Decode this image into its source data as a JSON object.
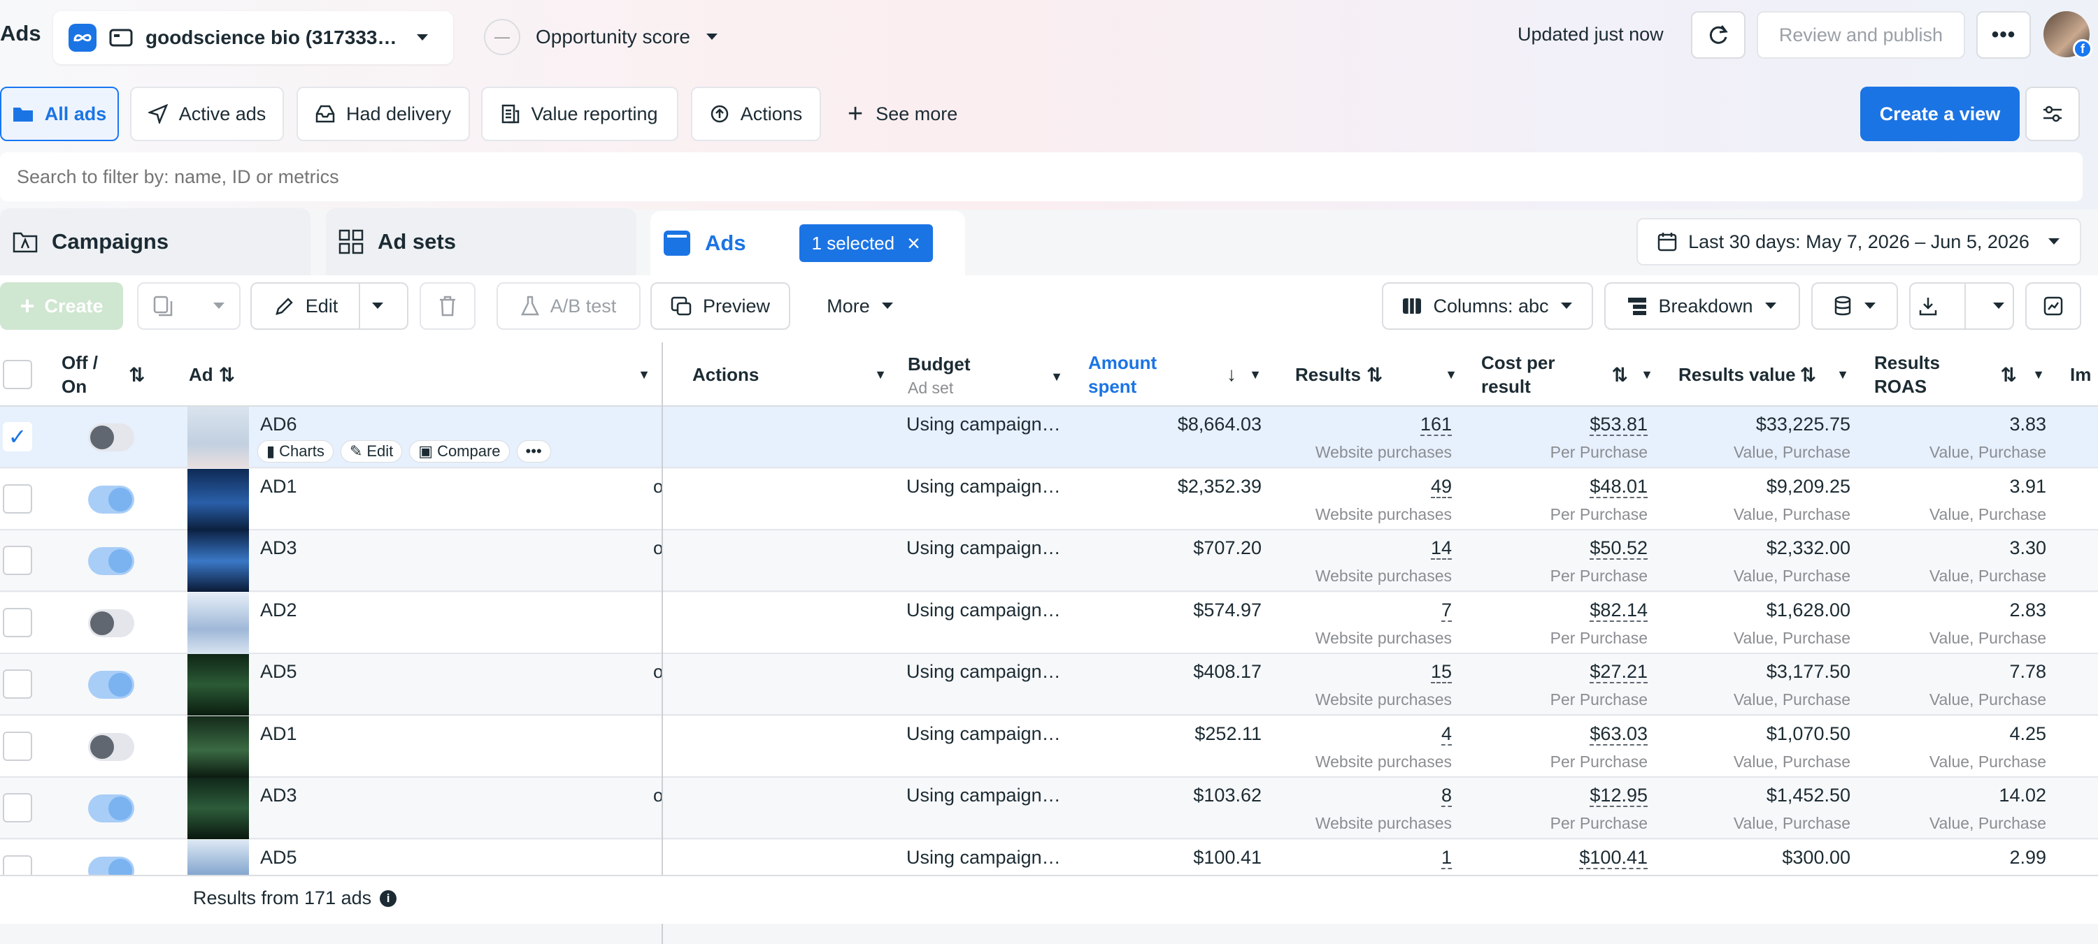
{
  "header": {
    "page_title": "Ads",
    "account_name": "goodscience bio (317333…",
    "opportunity_label": "Opportunity score",
    "opportunity_value": "—",
    "updated_text": "Updated just now",
    "review_publish": "Review and publish"
  },
  "views": {
    "tabs": [
      "All ads",
      "Active ads",
      "Had delivery",
      "Value reporting",
      "Actions"
    ],
    "see_more": "See more",
    "create_view": "Create a view"
  },
  "search": {
    "placeholder": "Search to filter by: name, ID or metrics"
  },
  "level_tabs": {
    "campaigns": "Campaigns",
    "ad_sets": "Ad sets",
    "ads": "Ads",
    "selected_badge": "1 selected"
  },
  "date_range": "Last 30 days: May 7, 2026 – Jun 5, 2026",
  "toolbar": {
    "create": "Create",
    "edit": "Edit",
    "ab_test": "A/B test",
    "preview": "Preview",
    "more": "More",
    "columns": "Columns: abc",
    "breakdown": "Breakdown"
  },
  "table": {
    "headers": {
      "off_on": "Off / On",
      "ad": "Ad",
      "actions": "Actions",
      "budget": "Budget",
      "budget_sub": "Ad set",
      "amount_spent": "Amount spent",
      "results": "Results",
      "cost_per_result": "Cost per result",
      "results_value": "Results value",
      "results_roas": "Results ROAS",
      "next_col": "Im"
    },
    "row_actions": {
      "charts": "Charts",
      "edit": "Edit",
      "compare": "Compare"
    },
    "rows": [
      {
        "name": "AD6",
        "on": false,
        "selected": true,
        "budget": "Using campaign…",
        "spent": "$8,664.03",
        "results": "161",
        "results_sub": "Website purchases",
        "cpr": "$53.81",
        "cpr_sub": "Per Purchase",
        "value": "$33,225.75",
        "value_sub": "Value, Purchase",
        "roas": "3.83",
        "roas_sub": "Value, Purchase",
        "action_mark": ""
      },
      {
        "name": "AD1",
        "on": true,
        "selected": false,
        "budget": "Using campaign…",
        "spent": "$2,352.39",
        "results": "49",
        "results_sub": "Website purchases",
        "cpr": "$48.01",
        "cpr_sub": "Per Purchase",
        "value": "$9,209.25",
        "value_sub": "Value, Purchase",
        "roas": "3.91",
        "roas_sub": "Value, Purchase",
        "action_mark": "ol"
      },
      {
        "name": "AD3",
        "on": true,
        "selected": false,
        "budget": "Using campaign…",
        "spent": "$707.20",
        "results": "14",
        "results_sub": "Website purchases",
        "cpr": "$50.52",
        "cpr_sub": "Per Purchase",
        "value": "$2,332.00",
        "value_sub": "Value, Purchase",
        "roas": "3.30",
        "roas_sub": "Value, Purchase",
        "action_mark": "ol"
      },
      {
        "name": "AD2",
        "on": false,
        "selected": false,
        "budget": "Using campaign…",
        "spent": "$574.97",
        "results": "7",
        "results_sub": "Website purchases",
        "cpr": "$82.14",
        "cpr_sub": "Per Purchase",
        "value": "$1,628.00",
        "value_sub": "Value, Purchase",
        "roas": "2.83",
        "roas_sub": "Value, Purchase",
        "action_mark": ""
      },
      {
        "name": "AD5",
        "on": true,
        "selected": false,
        "budget": "Using campaign…",
        "spent": "$408.17",
        "results": "15",
        "results_sub": "Website purchases",
        "cpr": "$27.21",
        "cpr_sub": "Per Purchase",
        "value": "$3,177.50",
        "value_sub": "Value, Purchase",
        "roas": "7.78",
        "roas_sub": "Value, Purchase",
        "action_mark": "ol"
      },
      {
        "name": "AD1",
        "on": false,
        "selected": false,
        "budget": "Using campaign…",
        "spent": "$252.11",
        "results": "4",
        "results_sub": "Website purchases",
        "cpr": "$63.03",
        "cpr_sub": "Per Purchase",
        "value": "$1,070.50",
        "value_sub": "Value, Purchase",
        "roas": "4.25",
        "roas_sub": "Value, Purchase",
        "action_mark": ""
      },
      {
        "name": "AD3",
        "on": true,
        "selected": false,
        "budget": "Using campaign…",
        "spent": "$103.62",
        "results": "8",
        "results_sub": "Website purchases",
        "cpr": "$12.95",
        "cpr_sub": "Per Purchase",
        "value": "$1,452.50",
        "value_sub": "Value, Purchase",
        "roas": "14.02",
        "roas_sub": "Value, Purchase",
        "action_mark": "ol"
      },
      {
        "name": "AD5",
        "on": true,
        "selected": false,
        "budget": "Using campaign…",
        "spent": "$100.41",
        "results": "1",
        "results_sub": "",
        "cpr": "$100.41",
        "cpr_sub": "",
        "value": "$300.00",
        "value_sub": "",
        "roas": "2.99",
        "roas_sub": "",
        "action_mark": ""
      }
    ],
    "footer": "Results from 171 ads"
  },
  "colors": {
    "primary": "#1877f2",
    "create_view_bg": "#1b74e4",
    "selected_row": "#e7f0fd",
    "badge_bg": "#1b74e4",
    "toggle_on": "#a8cdf7",
    "toggle_off": "#e4e6eb"
  }
}
